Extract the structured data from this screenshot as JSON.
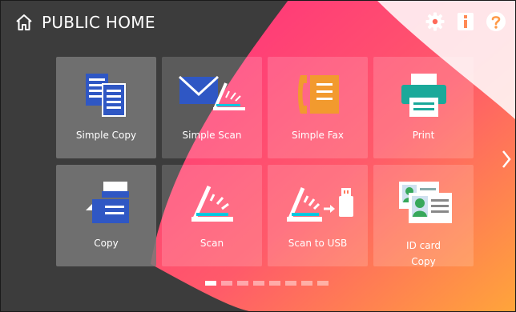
{
  "header": {
    "title": "PUBLIC HOME",
    "icons": [
      "home-icon",
      "settings-gear-icon",
      "info-icon",
      "help-icon"
    ]
  },
  "tiles": [
    {
      "label": "Simple Copy",
      "icon": "documents-copy-icon"
    },
    {
      "label": "Simple Scan",
      "icon": "envelope-scan-icon"
    },
    {
      "label": "Simple Fax",
      "icon": "fax-phone-icon"
    },
    {
      "label": "Print",
      "icon": "printer-icon"
    },
    {
      "label": "Copy",
      "icon": "copier-icon"
    },
    {
      "label": "Scan",
      "icon": "scanner-icon"
    },
    {
      "label": "Scan to USB",
      "icon": "scan-to-usb-icon"
    },
    {
      "label": "ID card\nCopy",
      "icon": "id-card-icon"
    }
  ],
  "pager": {
    "pages": 8,
    "current": 1
  },
  "colors": {
    "background": "#3c3c3c",
    "wave_start": "#ff2e7e",
    "wave_end": "#ffa53a",
    "icon_blue": "#2f57c4",
    "icon_teal": "#1aa99a",
    "icon_orange": "#f29a2e",
    "icon_green": "#37a85a"
  }
}
